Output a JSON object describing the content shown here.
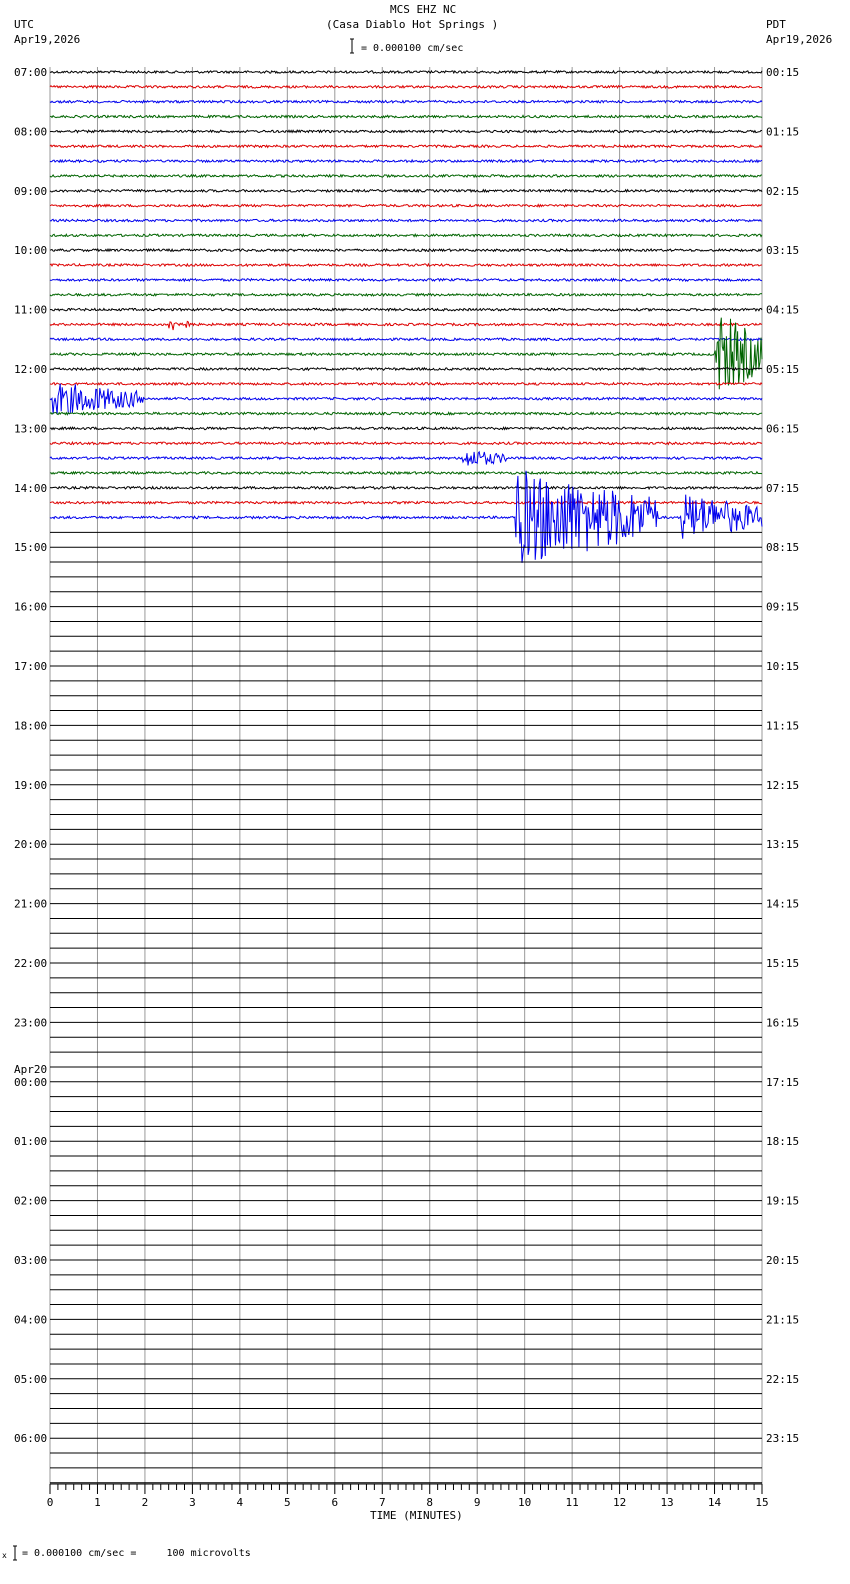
{
  "header": {
    "station": "MCS EHZ NC",
    "location": "(Casa Diablo Hot Springs )",
    "left_tz": "UTC",
    "left_date": "Apr19,2026",
    "right_tz": "PDT",
    "right_date": "Apr19,2026",
    "scale": "= 0.000100 cm/sec"
  },
  "footer": {
    "scale": "= 0.000100 cm/sec =     100 microvolts",
    "mark": "x"
  },
  "chart_data": {
    "type": "line",
    "title": "MCS EHZ NC (Casa Diablo Hot Springs )",
    "xlabel": "TIME (MINUTES)",
    "xlim": [
      0,
      15
    ],
    "x_ticks": [
      "0",
      "1",
      "2",
      "3",
      "4",
      "5",
      "6",
      "7",
      "8",
      "9",
      "10",
      "11",
      "12",
      "13",
      "14",
      "15"
    ],
    "lines_per_hour": 4,
    "trace_colors": [
      "#000000",
      "#dd0000",
      "#0000ee",
      "#006400"
    ],
    "traces_with_data": 31,
    "left_labels": [
      "07:00",
      "08:00",
      "09:00",
      "10:00",
      "11:00",
      "12:00",
      "13:00",
      "14:00",
      "15:00",
      "16:00",
      "17:00",
      "18:00",
      "19:00",
      "20:00",
      "21:00",
      "22:00",
      "23:00",
      "00:00",
      "01:00",
      "02:00",
      "03:00",
      "04:00",
      "05:00",
      "06:00"
    ],
    "left_date_change": "Apr20",
    "right_labels": [
      "00:15",
      "01:15",
      "02:15",
      "03:15",
      "04:15",
      "05:15",
      "06:15",
      "07:15",
      "08:15",
      "09:15",
      "10:15",
      "11:15",
      "12:15",
      "13:15",
      "14:15",
      "15:15",
      "16:15",
      "17:15",
      "18:15",
      "19:15",
      "20:15",
      "21:15",
      "22:15",
      "23:15"
    ],
    "events": [
      {
        "line": 17,
        "start_min": 2.5,
        "end_min": 3.0,
        "amp": 1.4
      },
      {
        "line": 22,
        "start_min": 0.0,
        "end_min": 2.0,
        "amp": 3.5
      },
      {
        "line": 26,
        "start_min": 8.7,
        "end_min": 9.6,
        "amp": 2.0
      },
      {
        "line": 30,
        "start_min": 9.8,
        "end_min": 12.8,
        "amp": 10.0
      },
      {
        "line": 30,
        "start_min": 13.3,
        "end_min": 15.0,
        "amp": 5.0
      },
      {
        "line": 19,
        "start_min": 14.0,
        "end_min": 15.0,
        "amp": 9.0
      },
      {
        "line": 31,
        "start_min": 0.0,
        "end_min": 0.8,
        "amp": 1.2
      },
      {
        "line": 31,
        "start_min": 2.7,
        "end_min": 3.2,
        "amp": 1.2
      }
    ]
  }
}
